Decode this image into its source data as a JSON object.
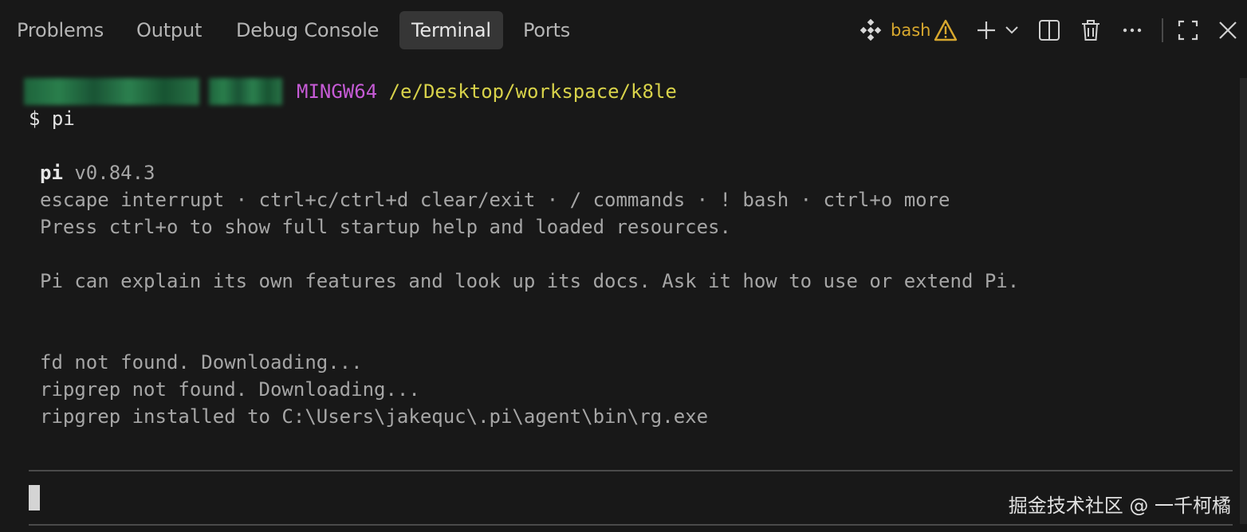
{
  "tabs": [
    {
      "label": "Problems",
      "active": false
    },
    {
      "label": "Output",
      "active": false
    },
    {
      "label": "Debug Console",
      "active": false
    },
    {
      "label": "Terminal",
      "active": true
    },
    {
      "label": "Ports",
      "active": false
    }
  ],
  "toolbar": {
    "shell_icon": "terminal-shell-icon",
    "shell_label": "bash",
    "warning_icon": "warning-icon",
    "new_terminal_icon": "plus-icon",
    "launch_profile_icon": "chevron-down-icon",
    "split_icon": "split-terminal-icon",
    "kill_icon": "trash-icon",
    "more_icon": "ellipsis-icon",
    "maximize_icon": "maximize-icon",
    "close_icon": "close-icon",
    "accent_warning": "#d8a82e"
  },
  "terminal": {
    "host": "MINGW64",
    "cwd": "/e/Desktop/workspace/k8le",
    "prompt_symbol": "$",
    "command": "pi",
    "app_name": "pi",
    "app_version": "v0.84.3",
    "hint_line": "escape interrupt · ctrl+c/ctrl+d clear/exit · / commands · ! bash · ctrl+o more",
    "help_line": "Press ctrl+o to show full startup help and loaded resources.",
    "info_line": "Pi can explain its own features and look up its docs. Ask it how to use or extend Pi.",
    "log": [
      "fd not found. Downloading...",
      "ripgrep not found. Downloading...",
      "ripgrep installed to C:\\Users\\jakequc\\.pi\\agent\\bin\\rg.exe"
    ],
    "colors": {
      "host": "#c65bd6",
      "path": "#d8d24a",
      "background": "#181818"
    }
  },
  "watermark": "掘金技术社区 @ 一千柯橘"
}
